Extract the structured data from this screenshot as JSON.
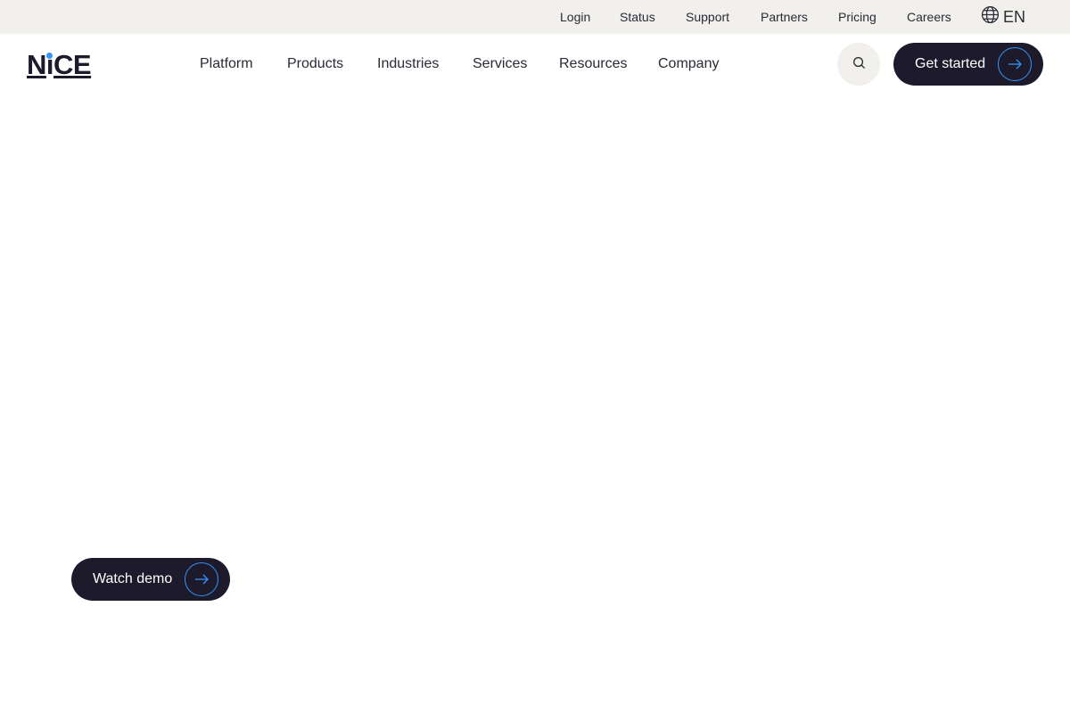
{
  "utility_nav": {
    "items": [
      {
        "label": "Login"
      },
      {
        "label": "Status"
      },
      {
        "label": "Support"
      },
      {
        "label": "Partners"
      },
      {
        "label": "Pricing"
      },
      {
        "label": "Careers"
      }
    ],
    "language": {
      "code": "EN",
      "icon": "globe-icon"
    }
  },
  "brand": {
    "logo_text_left": "N",
    "logo_text_i": "i",
    "logo_text_right": "CE",
    "dot_color": "#3694fc"
  },
  "main_nav": {
    "items": [
      {
        "label": "Platform"
      },
      {
        "label": "Products"
      },
      {
        "label": "Industries"
      },
      {
        "label": "Services"
      },
      {
        "label": "Resources"
      },
      {
        "label": "Company"
      }
    ],
    "search_icon": "search-icon",
    "cta_label": "Get started",
    "cta_icon": "arrow-right-icon"
  },
  "hero": {
    "watch_demo_label": "Watch demo",
    "watch_demo_icon": "arrow-right-icon"
  },
  "colors": {
    "topbar_bg": "#f1f0ed",
    "button_dark": "#1d1b2b",
    "accent_blue": "#3694fc"
  }
}
